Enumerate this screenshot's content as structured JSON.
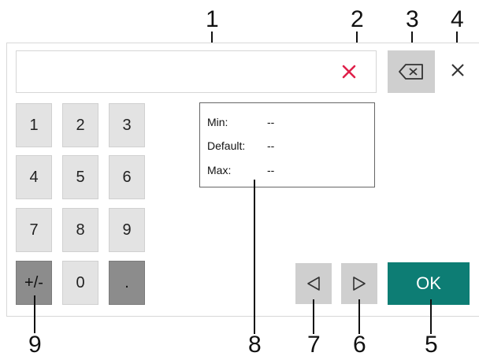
{
  "callouts": {
    "c1": "1",
    "c2": "2",
    "c3": "3",
    "c4": "4",
    "c5": "5",
    "c6": "6",
    "c7": "7",
    "c8": "8",
    "c9": "9"
  },
  "input": {
    "value": ""
  },
  "keypad": {
    "k1": "1",
    "k2": "2",
    "k3": "3",
    "k4": "4",
    "k5": "5",
    "k6": "6",
    "k7": "7",
    "k8": "8",
    "k9": "9",
    "sign": "+/-",
    "k0": "0",
    "dot": "."
  },
  "info": {
    "min_label": "Min:",
    "min_value": "--",
    "default_label": "Default:",
    "default_value": "--",
    "max_label": "Max:",
    "max_value": "--"
  },
  "ok_label": "OK",
  "icons": {
    "clear": "clear-icon",
    "backspace": "backspace-icon",
    "close": "close-icon",
    "left": "arrow-left-icon",
    "right": "arrow-right-icon"
  },
  "colors": {
    "ok": "#0d7d74",
    "clear": "#e0204a",
    "key": "#e3e3e3",
    "key_dark": "#8c8c8c",
    "nav": "#cfcfcf"
  }
}
